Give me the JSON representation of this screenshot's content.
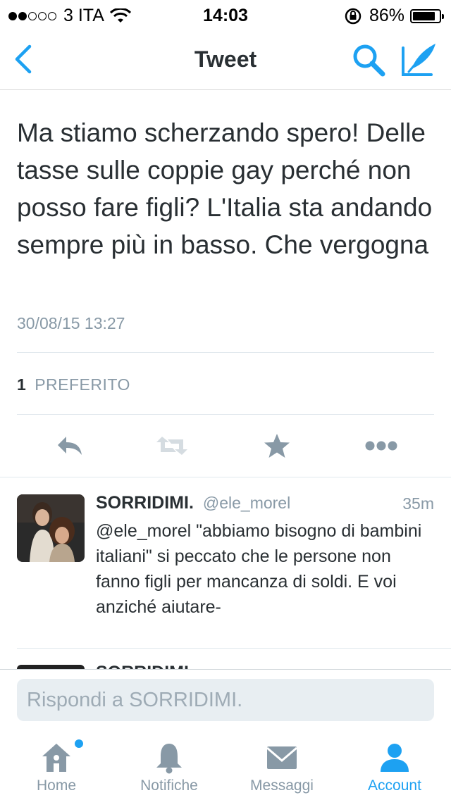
{
  "status_bar": {
    "carrier": "3 ITA",
    "time": "14:03",
    "battery_percent_text": "86%",
    "battery_level": 0.86
  },
  "nav": {
    "title": "Tweet",
    "icons": {
      "back": "chevron-left-icon",
      "search": "search-icon",
      "compose": "compose-icon"
    }
  },
  "tweet": {
    "text": "Ma stiamo scherzando spero! Delle tasse sulle coppie gay perché non posso fare figli? L'Italia sta andando sempre più in basso. Che vergogna",
    "timestamp": "30/08/15 13:27",
    "favorites_count": "1",
    "favorites_label": "PREFERITO"
  },
  "actions": [
    {
      "name": "reply-icon"
    },
    {
      "name": "retweet-icon"
    },
    {
      "name": "star-icon"
    },
    {
      "name": "more-icon"
    }
  ],
  "reply": {
    "name": "SORRIDIMI.",
    "handle": "@ele_morel",
    "time": "35m",
    "text": "@ele_morel \"abbiamo bisogno di bambini italiani\" si peccato che le persone non fanno figli per mancanza di soldi. E voi anziché aiutare-"
  },
  "next_reply": {
    "name": "SORRIDIMI."
  },
  "reply_input": {
    "placeholder": "Rispondi a SORRIDIMI."
  },
  "tab_bar": {
    "tabs": [
      {
        "label": "Home",
        "icon": "home-icon",
        "active": false,
        "has_badge": true
      },
      {
        "label": "Notifiche",
        "icon": "bell-icon",
        "active": false
      },
      {
        "label": "Messaggi",
        "icon": "envelope-icon",
        "active": false
      },
      {
        "label": "Account",
        "icon": "person-icon",
        "active": true
      }
    ]
  },
  "colors": {
    "accent": "#1da1f2",
    "text": "#292f33",
    "muted": "#8899a6"
  }
}
